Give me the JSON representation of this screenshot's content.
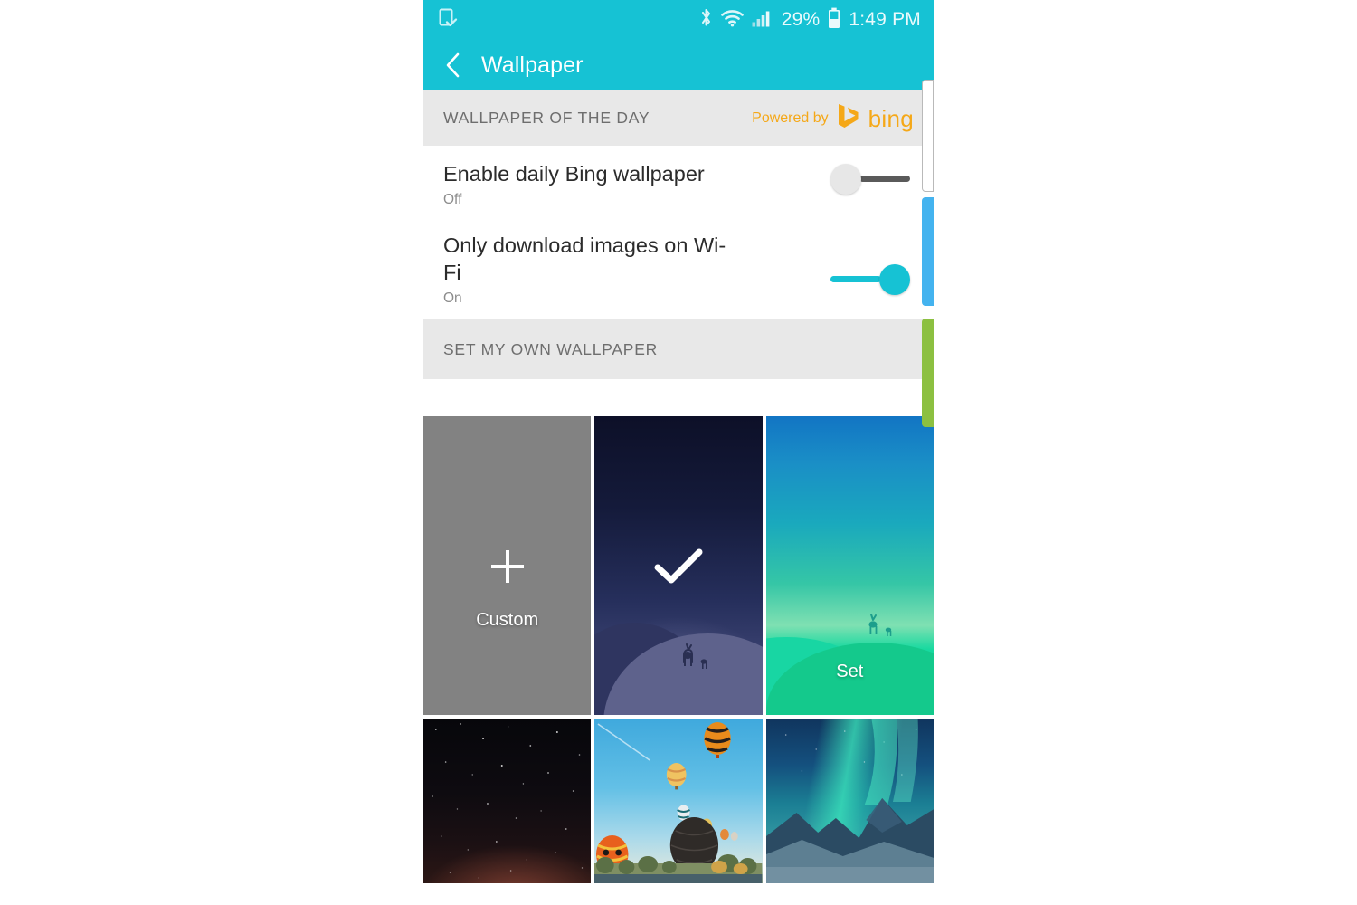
{
  "statusbar": {
    "left_icon": "device-check-icon",
    "icons": [
      "bluetooth-icon",
      "wifi-icon",
      "signal-icon",
      "battery-icon"
    ],
    "battery_percent": "29%",
    "time": "1:49 PM"
  },
  "titlebar": {
    "back_icon": "back-chevron-icon",
    "title": "Wallpaper"
  },
  "sections": {
    "wallpaper_of_the_day": {
      "label": "WALLPAPER OF THE DAY",
      "powered_by": "Powered by",
      "brand": "bing"
    },
    "set_my_own": {
      "label": "SET MY OWN WALLPAPER"
    }
  },
  "settings": [
    {
      "title": "Enable daily Bing wallpaper",
      "value": "Off",
      "state": "off"
    },
    {
      "title": "Only download images on Wi-Fi",
      "value": "On",
      "state": "on"
    }
  ],
  "wallpapers": [
    {
      "name": "custom",
      "label": "Custom",
      "icon": "plus-icon",
      "selected": false
    },
    {
      "name": "night-deer",
      "label": "",
      "icon": "check-icon",
      "selected": true
    },
    {
      "name": "green-hills-deer",
      "label": "Set",
      "icon": "",
      "selected": false
    },
    {
      "name": "starry-sky",
      "label": "",
      "icon": "",
      "selected": false
    },
    {
      "name": "hot-air-balloons",
      "label": "",
      "icon": "",
      "selected": false
    },
    {
      "name": "aurora-mountains",
      "label": "",
      "icon": "",
      "selected": false
    }
  ],
  "edge_panels": [
    {
      "name": "window-card",
      "color": "#ffffff"
    },
    {
      "name": "blue-panel",
      "color": "#44b3ef"
    },
    {
      "name": "green-panel",
      "color": "#8cc041"
    }
  ],
  "colors": {
    "accent": "#16c2d4",
    "section_bg": "#e8e8e8",
    "bing_amber": "#f5a818"
  }
}
